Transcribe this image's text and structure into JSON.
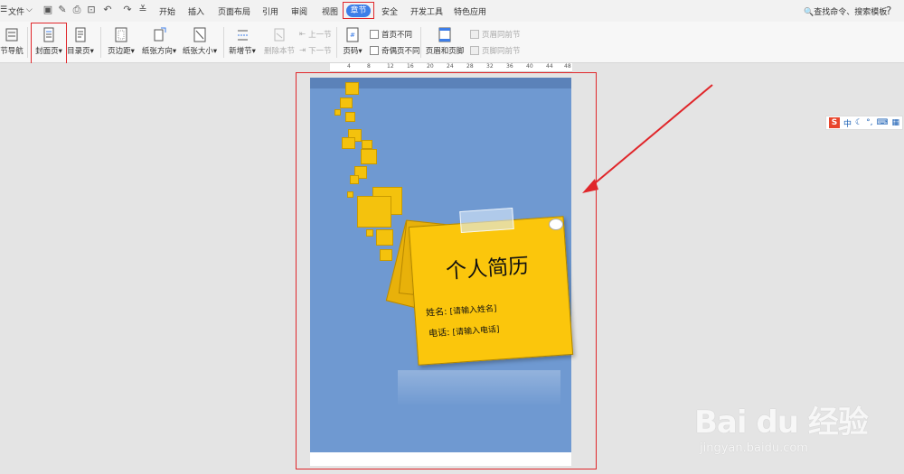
{
  "menubar": {
    "file_menu": "文件",
    "tabs": [
      {
        "label": "开始"
      },
      {
        "label": "插入"
      },
      {
        "label": "页面布局"
      },
      {
        "label": "引用"
      },
      {
        "label": "审阅"
      },
      {
        "label": "视图"
      },
      {
        "label": "章节",
        "active": true
      },
      {
        "label": "安全"
      },
      {
        "label": "开发工具"
      },
      {
        "label": "特色应用"
      }
    ],
    "search_label": "查找命令、搜索模板",
    "help_label": "?"
  },
  "ribbon": {
    "section_nav": "节导航",
    "cover_page": "封面页",
    "toc_page": "目录页",
    "margins": "页边距",
    "orientation": "纸张方向",
    "paper_size": "纸张大小",
    "new_section": "新增节",
    "delete_section": "删除本节",
    "prev_section": "上一节",
    "next_section": "下一节",
    "page_number": "页码",
    "first_page_diff": "首页不同",
    "odd_even_diff": "奇偶页不同",
    "header_footer": "页眉和页脚",
    "same_as_prev_header": "页眉同前节",
    "same_as_prev_footer": "页脚同前节"
  },
  "ruler": {
    "ticks": [
      "4",
      "8",
      "12",
      "16",
      "20",
      "24",
      "28",
      "32",
      "36",
      "40",
      "44",
      "48"
    ]
  },
  "cover": {
    "title": "个人简历",
    "name_label": "姓名:",
    "name_placeholder": "[请输入姓名]",
    "phone_label": "电话:",
    "phone_placeholder": "[请输入电话]"
  },
  "ime": {
    "logo": "S",
    "mode": "中"
  },
  "watermark": {
    "brand": "Bai du 经验",
    "url": "jingyan.baidu.com"
  },
  "colors": {
    "accent_tab": "#3d7ee8",
    "highlight_red": "#e0262a",
    "cover_blue": "#6f99d1",
    "sticky_yellow": "#fbc60c"
  }
}
